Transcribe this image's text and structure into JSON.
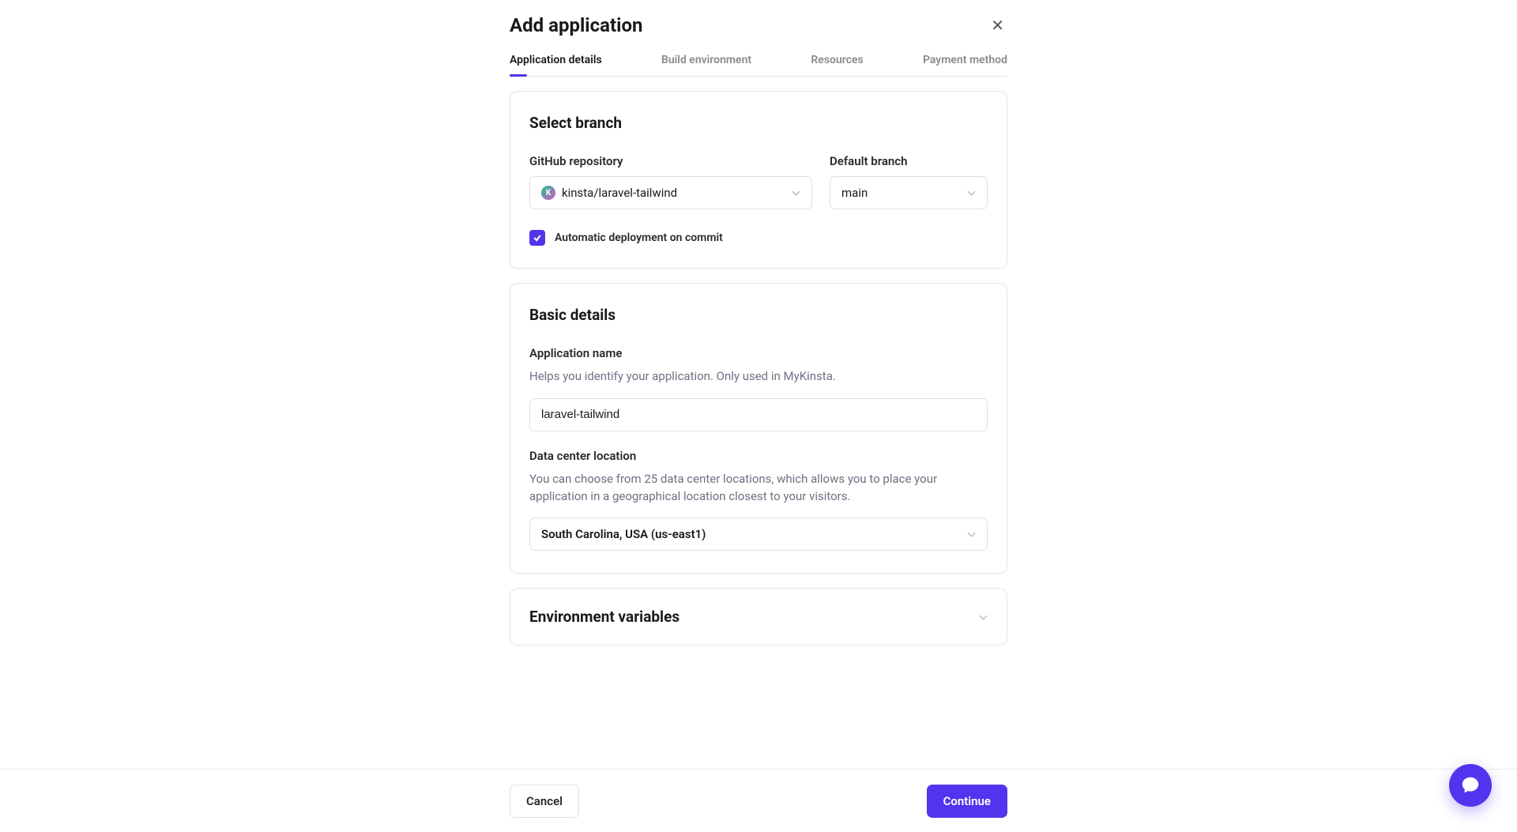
{
  "header": {
    "title": "Add application"
  },
  "tabs": {
    "items": [
      {
        "label": "Application details"
      },
      {
        "label": "Build environment"
      },
      {
        "label": "Resources"
      },
      {
        "label": "Payment method"
      }
    ],
    "active_index": 0
  },
  "branch": {
    "section_title": "Select branch",
    "repo_label": "GitHub repository",
    "repo_value": "kinsta/laravel-tailwind",
    "branch_label": "Default branch",
    "branch_value": "main",
    "autodeploy_label": "Automatic deployment on commit",
    "autodeploy_checked": true
  },
  "basic": {
    "section_title": "Basic details",
    "name_label": "Application name",
    "name_help": "Helps you identify your application. Only used in MyKinsta.",
    "name_value": "laravel-tailwind",
    "dc_label": "Data center location",
    "dc_help": "You can choose from 25 data center locations, which allows you to place your application in a geographical location closest to your visitors.",
    "dc_value": "South Carolina, USA (us-east1)"
  },
  "env": {
    "section_title": "Environment variables"
  },
  "footer": {
    "cancel": "Cancel",
    "continue": "Continue"
  }
}
